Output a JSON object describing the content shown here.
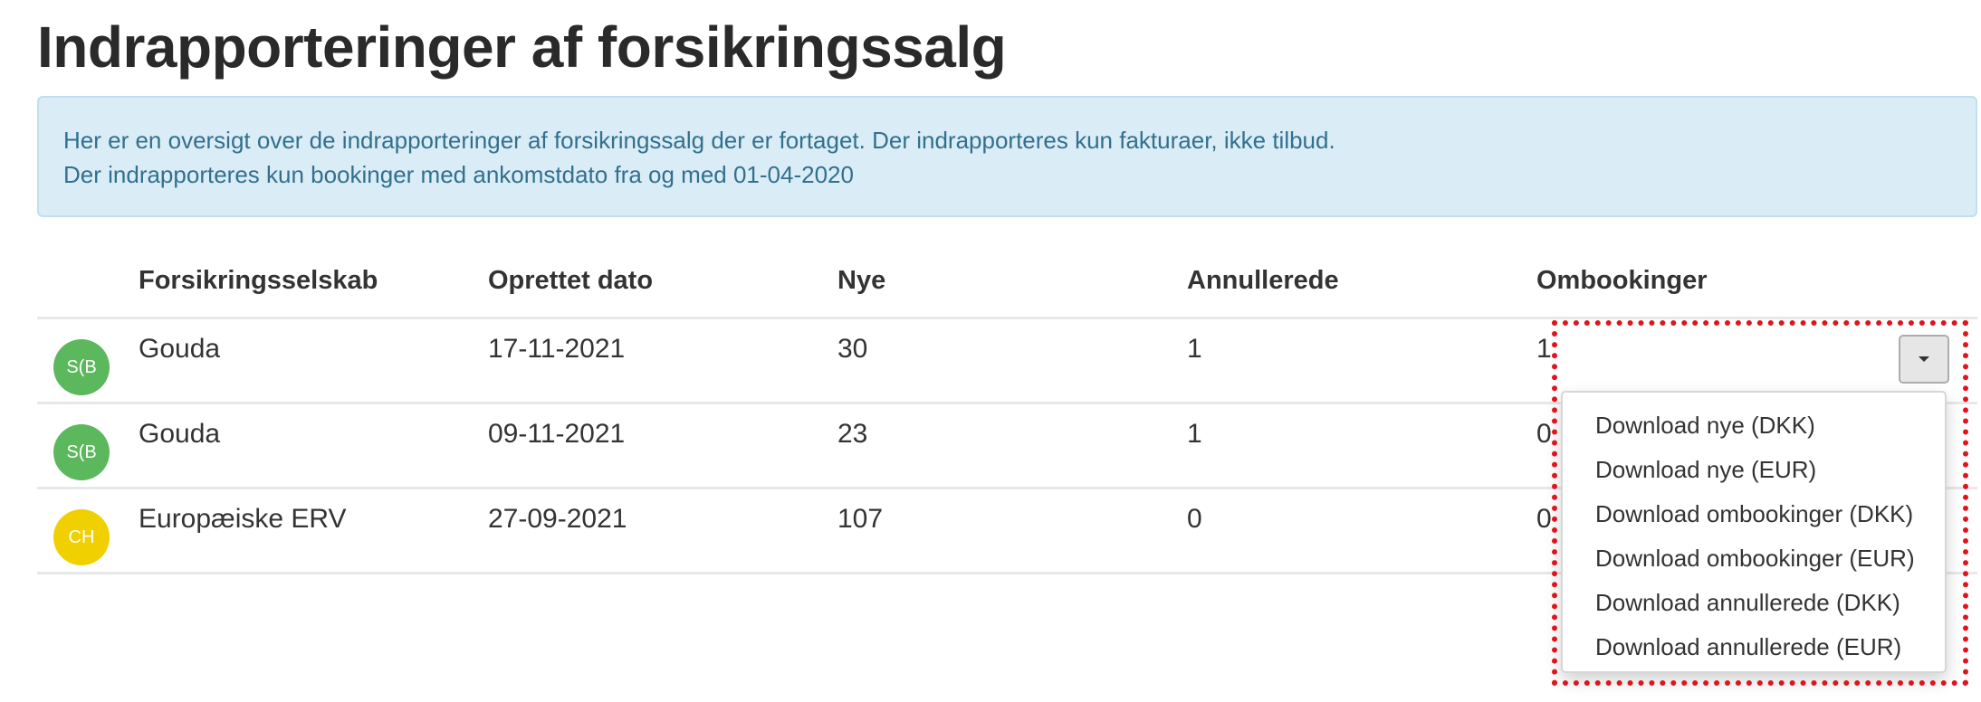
{
  "page": {
    "title": "Indrapporteringer af forsikringssalg"
  },
  "info": {
    "line1": "Her er en oversigt over de indrapporteringer af forsikringssalg der er fortaget. Der indrapporteres kun fakturaer, ikke tilbud.",
    "line2": "Der indrapporteres kun bookinger med ankomstdato fra og med 01-04-2020"
  },
  "table": {
    "headers": [
      "Forsikringsselskab",
      "Oprettet dato",
      "Nye",
      "Annullerede",
      "Ombookinger"
    ],
    "rows": [
      {
        "avatar": "S(B",
        "avatar_color": "#5cb85c",
        "company": "Gouda",
        "date": "17-11-2021",
        "new": "30",
        "cancelled": "1",
        "rebookings": "1"
      },
      {
        "avatar": "S(B",
        "avatar_color": "#5cb85c",
        "company": "Gouda",
        "date": "09-11-2021",
        "new": "23",
        "cancelled": "1",
        "rebookings": "0"
      },
      {
        "avatar": "CH",
        "avatar_color": "#f0d000",
        "company": "Europæiske ERV",
        "date": "27-09-2021",
        "new": "107",
        "cancelled": "0",
        "rebookings": "0"
      }
    ]
  },
  "dropdown": {
    "toggle_icon": "caret-down-icon",
    "items": [
      "Download nye (DKK)",
      "Download nye (EUR)",
      "Download ombookinger (DKK)",
      "Download ombookinger (EUR)",
      "Download annullerede (DKK)",
      "Download annullerede (EUR)"
    ]
  },
  "colors": {
    "info_bg": "#daedf6",
    "info_text": "#31708f",
    "highlight": "#e0141b",
    "avatar_green": "#5cb85c",
    "avatar_yellow": "#f0d000"
  }
}
